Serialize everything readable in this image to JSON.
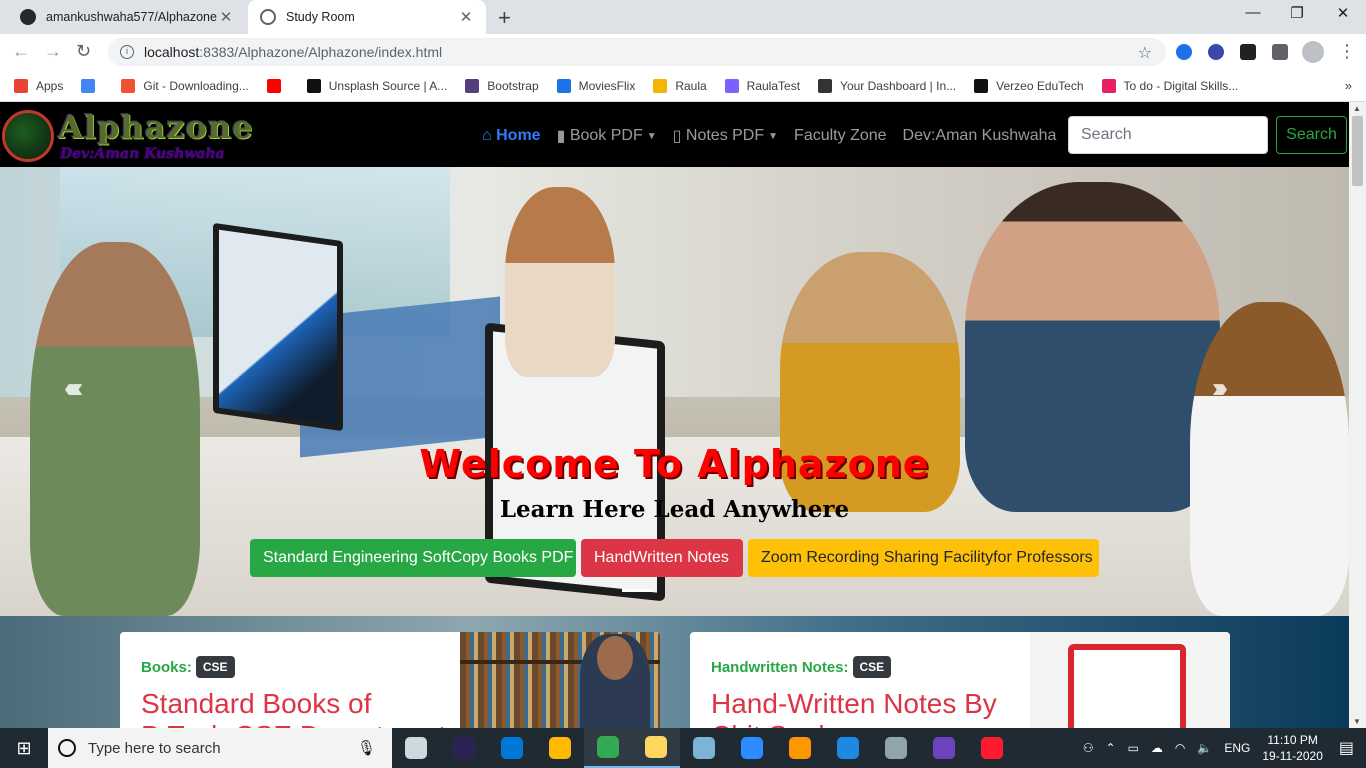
{
  "browser": {
    "tabs": [
      {
        "title": "amankushwaha577/Alphazone",
        "active": false
      },
      {
        "title": "Study Room",
        "active": true
      }
    ],
    "new_tab": "+",
    "window_controls": {
      "minimize": "—",
      "restore": "❐",
      "close": "✕"
    },
    "url_host": "localhost",
    "url_rest": ":8383/Alphazone/Alphazone/index.html",
    "bookmarks": [
      {
        "label": "Apps",
        "color": "#ea4335"
      },
      {
        "label": "",
        "color": "#4285f4"
      },
      {
        "label": "Git - Downloading...",
        "color": "#f05133"
      },
      {
        "label": "",
        "color": "#ff0000"
      },
      {
        "label": "Unsplash Source | A...",
        "color": "#111111"
      },
      {
        "label": "Bootstrap",
        "color": "#563d7c"
      },
      {
        "label": "MoviesFlix",
        "color": "#1a73e8"
      },
      {
        "label": "Raula",
        "color": "#f4b400"
      },
      {
        "label": "RaulaTest",
        "color": "#7b61ff"
      },
      {
        "label": "Your Dashboard | In...",
        "color": "#333333"
      },
      {
        "label": "Verzeo EduTech",
        "color": "#111111"
      },
      {
        "label": "To do - Digital Skills...",
        "color": "#e91e63"
      }
    ],
    "bookmarks_more": "»"
  },
  "site": {
    "logo": {
      "brand": "Alphazone",
      "dev": "Dev:Aman Kushwaha"
    },
    "nav": {
      "home": "Home",
      "book_pdf": "Book PDF",
      "notes_pdf": "Notes PDF",
      "faculty_zone": "Faculty Zone",
      "dev": "Dev:Aman Kushwaha"
    },
    "search": {
      "placeholder": "Search",
      "button": "Search"
    },
    "hero": {
      "title": "Welcome To Alphazone",
      "tagline": "Learn Here Lead Anywhere",
      "buttons": [
        "Standard Engineering SoftCopy Books PDF",
        "HandWritten Notes",
        "Zoom Recording Sharing Facilityfor Professors"
      ],
      "prev": "‹‹‹‹",
      "next": "›››"
    },
    "cards": [
      {
        "label": "Books:",
        "badge": "CSE",
        "title_line1": "Standard Books of",
        "title_line2": "B.Tech CSE Department"
      },
      {
        "label": "Handwritten Notes:",
        "badge": "CSE",
        "title_line1": "Hand-Written Notes By",
        "title_line2": "Chit Saala"
      }
    ]
  },
  "taskbar": {
    "search_placeholder": "Type here to search",
    "language": "ENG",
    "time": "11:10 PM",
    "date": "19-11-2020",
    "apps": [
      {
        "name": "task-view",
        "color": "#cfd8dc"
      },
      {
        "name": "eclipse",
        "color": "#2c2255"
      },
      {
        "name": "edge",
        "color": "#0078d7"
      },
      {
        "name": "store",
        "color": "#ffb900"
      },
      {
        "name": "chrome",
        "color": "#34a853",
        "running": true
      },
      {
        "name": "file-explorer",
        "color": "#ffd75e",
        "running": true
      },
      {
        "name": "notepad-app",
        "color": "#7fb3d5"
      },
      {
        "name": "zoom",
        "color": "#2d8cff"
      },
      {
        "name": "sublime",
        "color": "#ff9800"
      },
      {
        "name": "virtualbox",
        "color": "#1e88e5"
      },
      {
        "name": "remote-desktop",
        "color": "#90a4ae"
      },
      {
        "name": "github-desktop",
        "color": "#6f42c1"
      },
      {
        "name": "opera",
        "color": "#ff1b2d"
      }
    ]
  }
}
